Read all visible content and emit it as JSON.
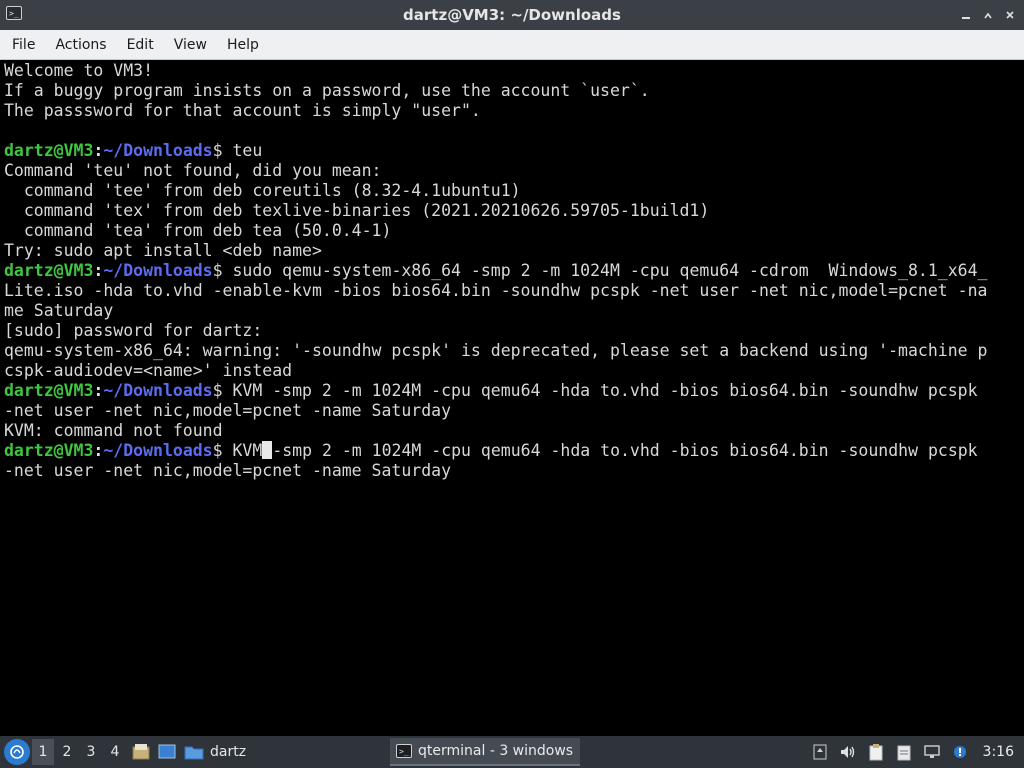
{
  "window": {
    "title": "dartz@VM3: ~/Downloads"
  },
  "menubar": {
    "items": [
      "File",
      "Actions",
      "Edit",
      "View",
      "Help"
    ]
  },
  "terminal": {
    "lines": [
      {
        "type": "text",
        "text": "Welcome to VM3!"
      },
      {
        "type": "text",
        "text": "If a buggy program insists on a password, use the account `user`."
      },
      {
        "type": "text",
        "text": "The passsword for that account is simply \"user\"."
      },
      {
        "type": "text",
        "text": ""
      },
      {
        "type": "prompt",
        "user": "dartz@VM3",
        "sep": ":",
        "path": "~/Downloads",
        "dollar": "$ ",
        "cmd": "teu"
      },
      {
        "type": "text",
        "text": "Command 'teu' not found, did you mean:"
      },
      {
        "type": "text",
        "text": "  command 'tee' from deb coreutils (8.32-4.1ubuntu1)"
      },
      {
        "type": "text",
        "text": "  command 'tex' from deb texlive-binaries (2021.20210626.59705-1build1)"
      },
      {
        "type": "text",
        "text": "  command 'tea' from deb tea (50.0.4-1)"
      },
      {
        "type": "text",
        "text": "Try: sudo apt install <deb name>"
      },
      {
        "type": "prompt",
        "user": "dartz@VM3",
        "sep": ":",
        "path": "~/Downloads",
        "dollar": "$ ",
        "cmd": "sudo qemu-system-x86_64 -smp 2 -m 1024M -cpu qemu64 -cdrom  Windows_8.1_x64_"
      },
      {
        "type": "text",
        "text": "Lite.iso -hda to.vhd -enable-kvm -bios bios64.bin -soundhw pcspk -net user -net nic,model=pcnet -na"
      },
      {
        "type": "text",
        "text": "me Saturday"
      },
      {
        "type": "text",
        "text": "[sudo] password for dartz:"
      },
      {
        "type": "text",
        "text": "qemu-system-x86_64: warning: '-soundhw pcspk' is deprecated, please set a backend using '-machine p"
      },
      {
        "type": "text",
        "text": "cspk-audiodev=<name>' instead"
      },
      {
        "type": "prompt",
        "user": "dartz@VM3",
        "sep": ":",
        "path": "~/Downloads",
        "dollar": "$ ",
        "cmd": "KVM -smp 2 -m 1024M -cpu qemu64 -hda to.vhd -bios bios64.bin -soundhw pcspk"
      },
      {
        "type": "text",
        "text": "-net user -net nic,model=pcnet -name Saturday"
      },
      {
        "type": "text",
        "text": "KVM: command not found"
      },
      {
        "type": "prompt_cursor",
        "user": "dartz@VM3",
        "sep": ":",
        "path": "~/Downloads",
        "dollar": "$ ",
        "cmd_before": "KVM",
        "cmd_after": "-smp 2 -m 1024M -cpu qemu64 -hda to.vhd -bios bios64.bin -soundhw pcspk"
      },
      {
        "type": "text",
        "text": "-net user -net nic,model=pcnet -name Saturday"
      }
    ]
  },
  "taskbar": {
    "desktops": [
      "1",
      "2",
      "3",
      "4"
    ],
    "active_desktop": "1",
    "folder_label": "dartz",
    "task_label": "qterminal - 3 windows",
    "clock": "3:16"
  },
  "colors": {
    "prompt_user": "#3fc63f",
    "prompt_path": "#5b6cf0",
    "terminal_bg": "#000000",
    "terminal_fg": "#d8d8d8"
  }
}
